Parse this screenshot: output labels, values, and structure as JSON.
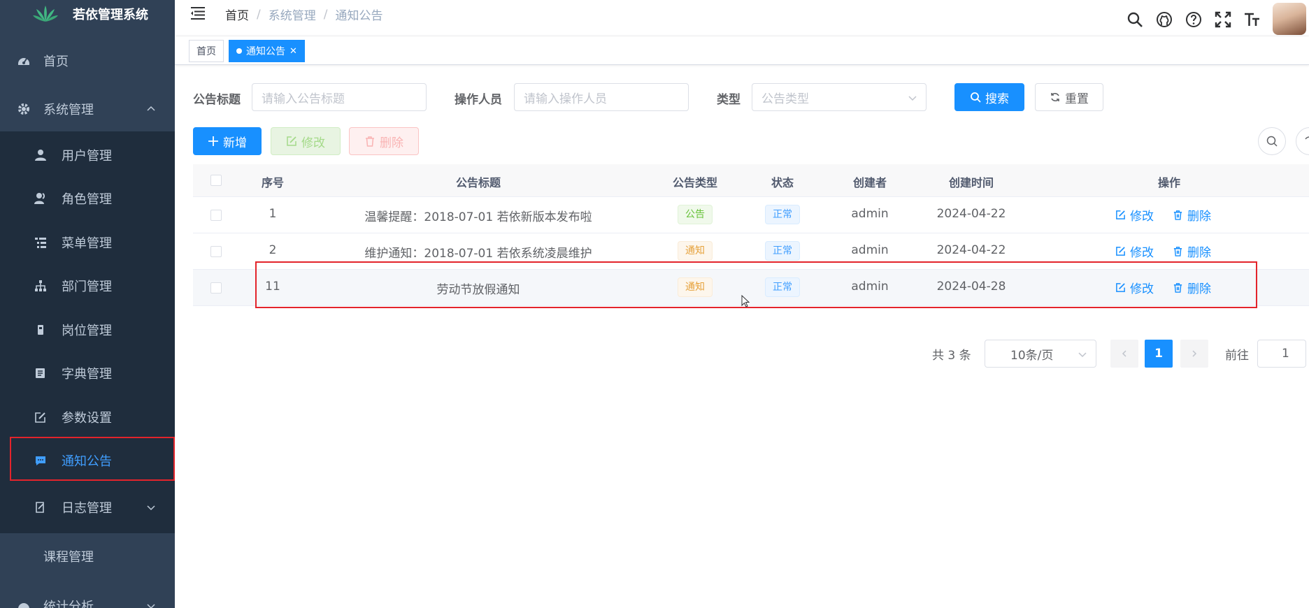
{
  "app": {
    "title": "若依管理系统"
  },
  "sidebar": {
    "items": [
      {
        "label": "首页",
        "icon": "dashboard-icon"
      },
      {
        "label": "系统管理",
        "icon": "gear-icon"
      },
      {
        "label": "用户管理",
        "icon": "user-icon"
      },
      {
        "label": "角色管理",
        "icon": "peoples-icon"
      },
      {
        "label": "菜单管理",
        "icon": "tree-table-icon"
      },
      {
        "label": "部门管理",
        "icon": "tree-icon"
      },
      {
        "label": "岗位管理",
        "icon": "post-icon"
      },
      {
        "label": "字典管理",
        "icon": "dict-icon"
      },
      {
        "label": "参数设置",
        "icon": "edit-icon"
      },
      {
        "label": "通知公告",
        "icon": "message-icon"
      },
      {
        "label": "日志管理",
        "icon": "log-icon"
      },
      {
        "label": "课程管理",
        "icon": ""
      },
      {
        "label": "统计分析",
        "icon": "chart-icon"
      }
    ],
    "active_color": "#409eff",
    "bg_color": "#304156",
    "sub_bg_color": "#1f2d3d"
  },
  "breadcrumb": [
    "首页",
    "系统管理",
    "通知公告"
  ],
  "tags": [
    {
      "label": "首页"
    },
    {
      "label": "通知公告"
    }
  ],
  "search": {
    "title_label": "公告标题",
    "title_placeholder": "请输入公告标题",
    "operator_label": "操作人员",
    "operator_placeholder": "请输入操作人员",
    "type_label": "类型",
    "type_placeholder": "公告类型",
    "search_button": "搜索",
    "reset_button": "重置"
  },
  "toolbar": {
    "add": "新增",
    "edit": "修改",
    "delete": "删除"
  },
  "table": {
    "headers": [
      "序号",
      "公告标题",
      "公告类型",
      "状态",
      "创建者",
      "创建时间",
      "操作"
    ],
    "rows": [
      {
        "id": "1",
        "title": "温馨提醒：2018-07-01 若依新版本发布啦",
        "type": "公告",
        "status": "正常",
        "creator": "admin",
        "created": "2024-04-22",
        "edit": "修改",
        "delete": "删除"
      },
      {
        "id": "2",
        "title": "维护通知：2018-07-01 若依系统凌晨维护",
        "type": "通知",
        "status": "正常",
        "creator": "admin",
        "created": "2024-04-22",
        "edit": "修改",
        "delete": "删除"
      },
      {
        "id": "11",
        "title": "劳动节放假通知",
        "type": "通知",
        "status": "正常",
        "creator": "admin",
        "created": "2024-04-28",
        "edit": "修改",
        "delete": "删除"
      }
    ]
  },
  "pagination": {
    "total": "共 3 条",
    "page_size": "10条/页",
    "current": "1",
    "goto_label": "前往",
    "goto_value": "1"
  },
  "colors": {
    "primary": "#1890ff",
    "highlight": "#e3242b"
  }
}
